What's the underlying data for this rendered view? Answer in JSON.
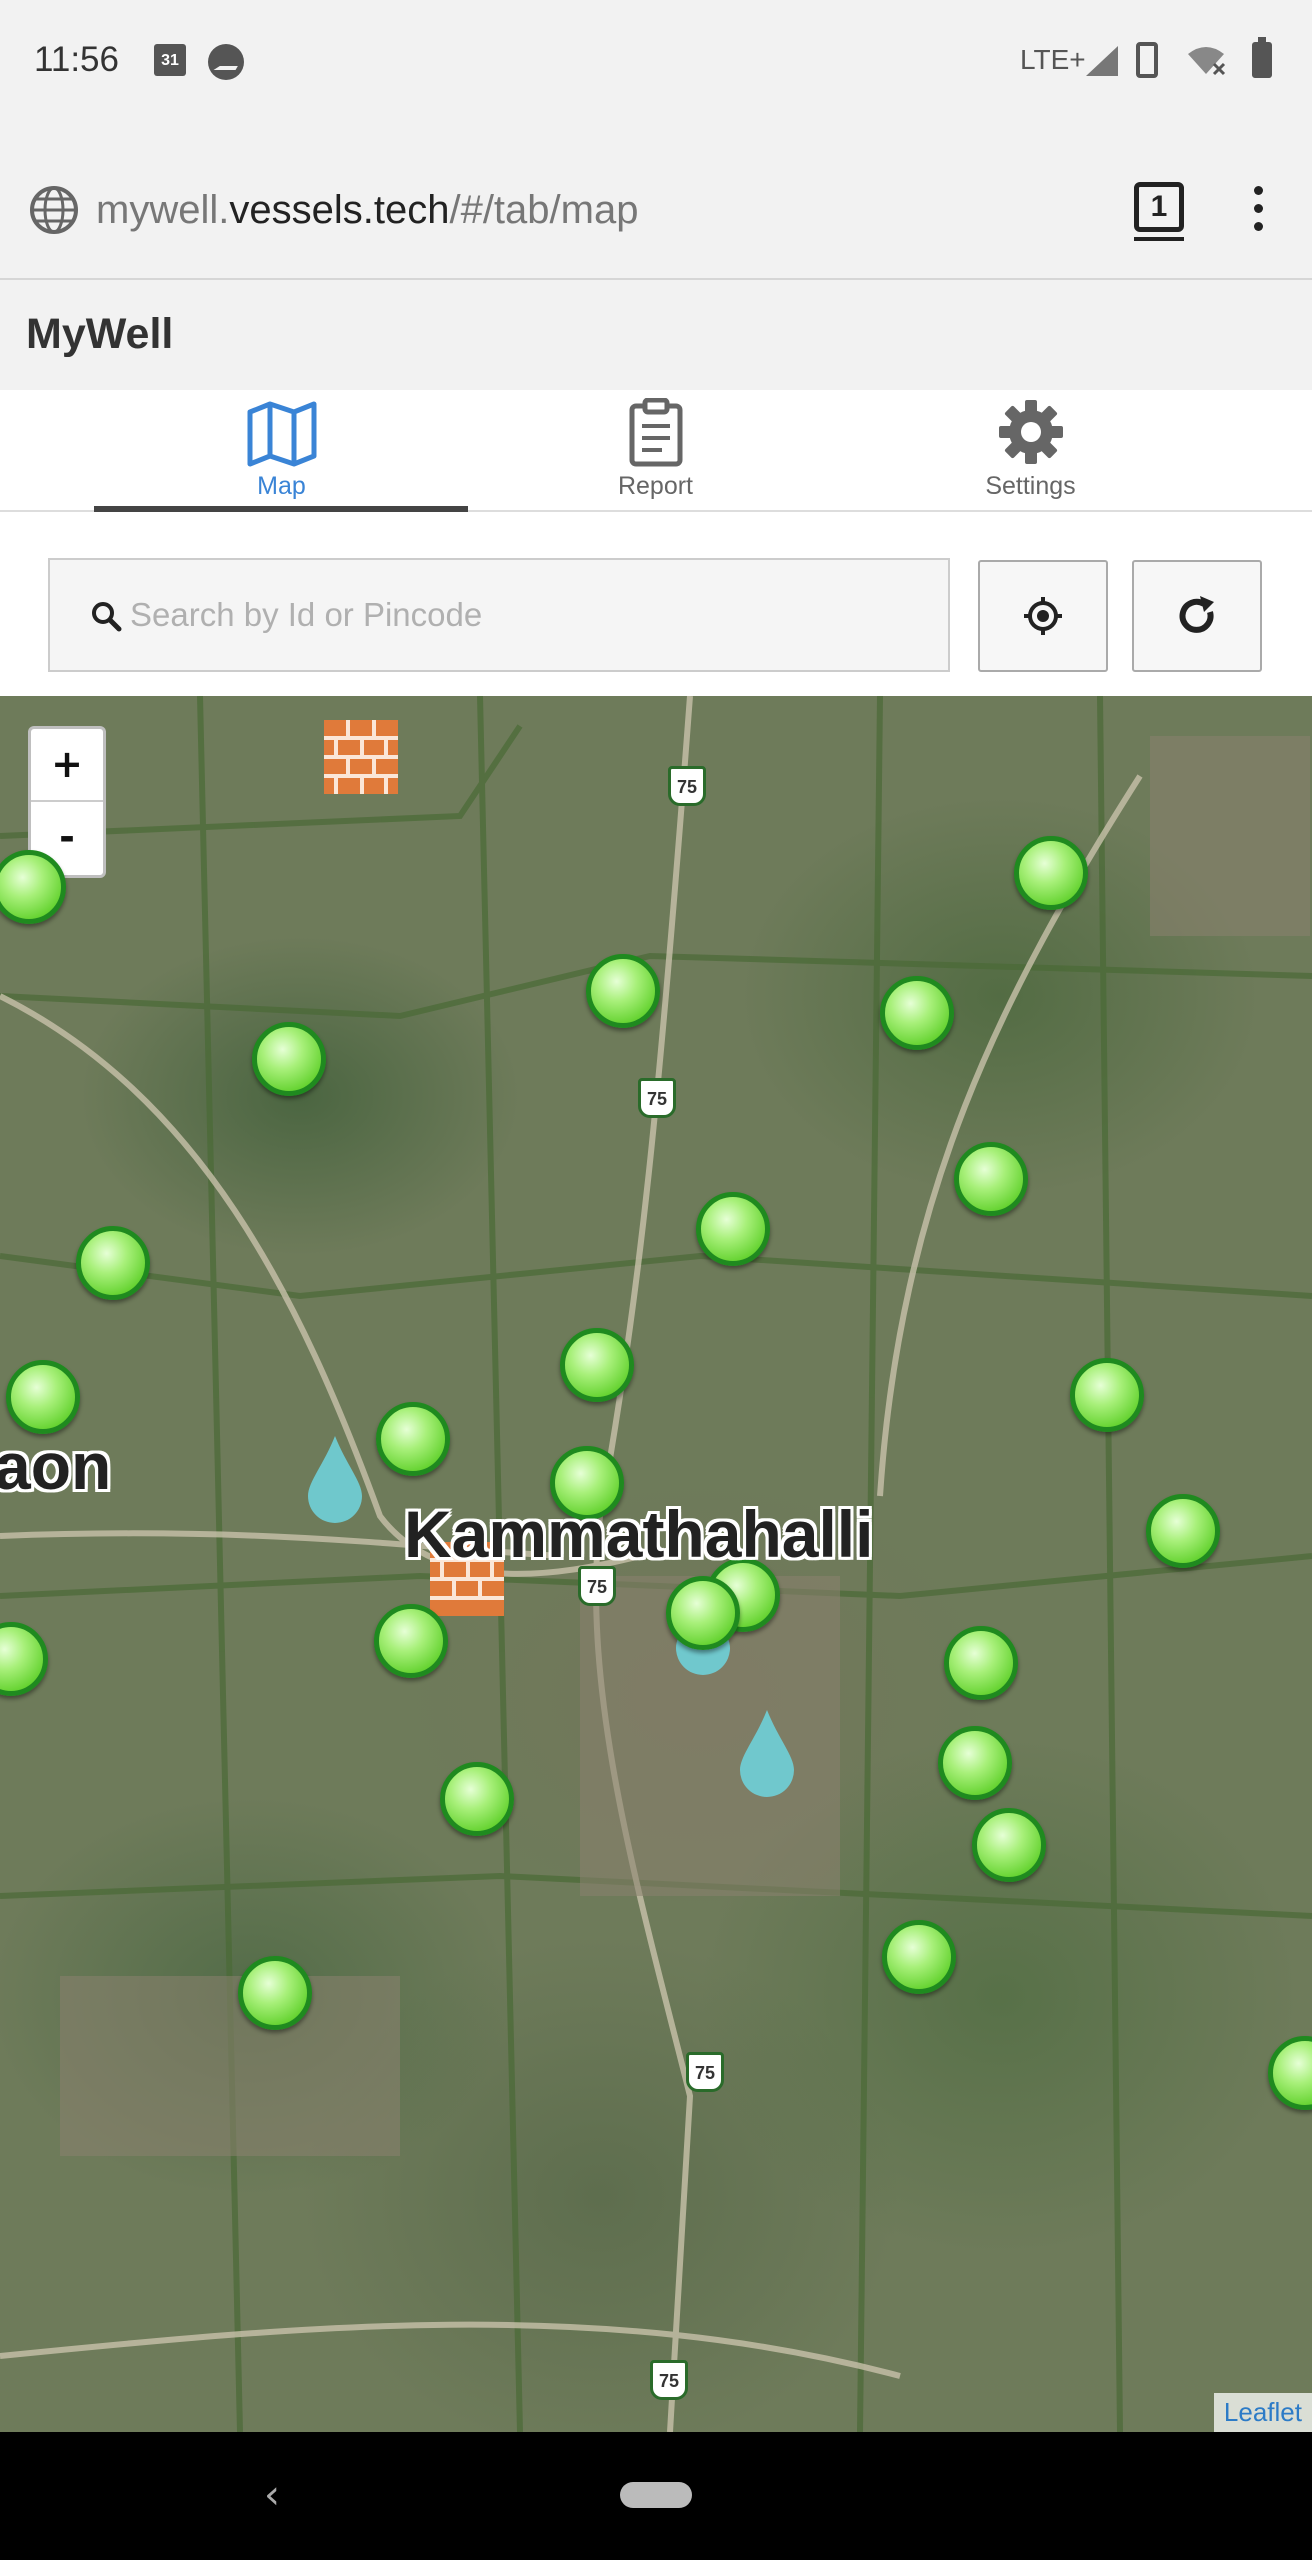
{
  "status_bar": {
    "time": "11:56",
    "calendar_day": "31",
    "network": "LTE+",
    "icons": [
      "calendar-icon",
      "messenger-icon",
      "signal-icon",
      "vibrate-icon",
      "wifi-off-icon",
      "battery-icon"
    ]
  },
  "browser": {
    "url_prefix": "mywell.",
    "url_domain": "vessels.tech",
    "url_path": "/#/tab/map",
    "tab_count": "1"
  },
  "app": {
    "title": "MyWell"
  },
  "tabs": [
    {
      "label": "Map",
      "icon": "map-icon",
      "active": true
    },
    {
      "label": "Report",
      "icon": "clipboard-icon",
      "active": false
    },
    {
      "label": "Settings",
      "icon": "gear-icon",
      "active": false
    }
  ],
  "search": {
    "placeholder": "Search by Id or Pincode",
    "value": ""
  },
  "map": {
    "zoom_in_label": "+",
    "zoom_out_label": "-",
    "place_labels": [
      "Kammathahalli",
      "aon"
    ],
    "road_number": "75",
    "attribution": "Leaflet",
    "accent_color": "#3a84d6",
    "marker_color": "#5fd02a"
  },
  "nav": {
    "back_label": "‹"
  }
}
